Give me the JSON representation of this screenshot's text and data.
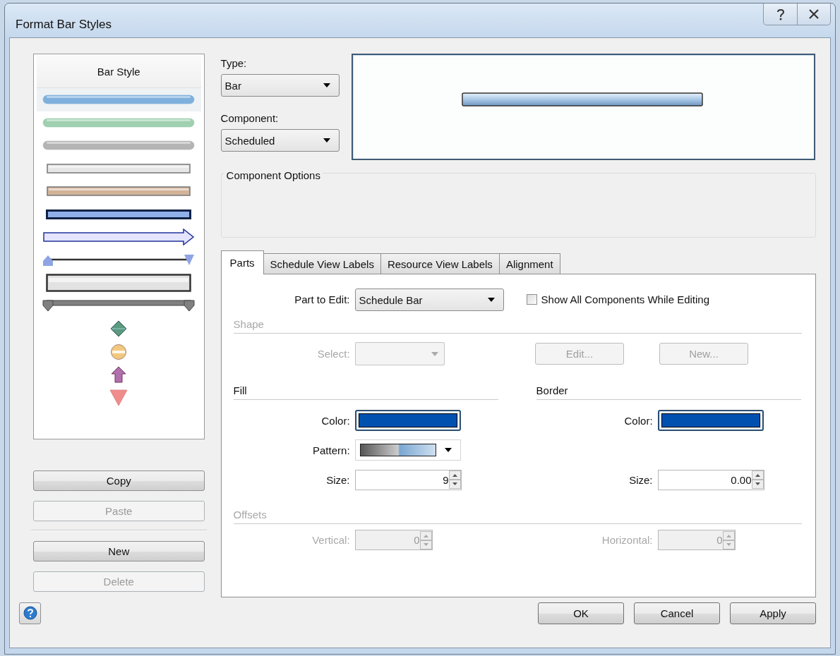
{
  "window": {
    "title": "Format Bar Styles"
  },
  "bar_styles": {
    "header": "Bar Style",
    "items": [
      {
        "kind": "rounded",
        "color": "#7fb0dd",
        "selected": true
      },
      {
        "kind": "rounded",
        "color": "#9fd0b0",
        "selected": false
      },
      {
        "kind": "rounded",
        "color": "#b4b4b4",
        "selected": false
      },
      {
        "kind": "flat",
        "color": "#e6e6e6",
        "selected": false
      },
      {
        "kind": "flat",
        "color": "#d2b398",
        "selected": false
      },
      {
        "kind": "outlined",
        "color": "#8fb0ea",
        "selected": false
      },
      {
        "kind": "arrow",
        "color": "#e4e4ff",
        "selected": false
      },
      {
        "kind": "range",
        "color": "#8ea4e4",
        "selected": false
      },
      {
        "kind": "box",
        "color": "#e2e2e2",
        "selected": false
      },
      {
        "kind": "span",
        "color": "#808080",
        "selected": false
      },
      {
        "kind": "diamond",
        "color": "#5a9a80",
        "selected": false
      },
      {
        "kind": "circle",
        "color": "#f2c87e",
        "selected": false
      },
      {
        "kind": "up-arrow",
        "color": "#b070b0",
        "selected": false
      },
      {
        "kind": "down-triangle",
        "color": "#f08c8c",
        "selected": false
      }
    ]
  },
  "list_buttons": [
    {
      "label": "Copy",
      "disabled": false
    },
    {
      "label": "Paste",
      "disabled": true
    },
    {
      "label": "New",
      "disabled": false
    },
    {
      "label": "Delete",
      "disabled": true
    }
  ],
  "type": {
    "label": "Type:",
    "value": "Bar"
  },
  "component": {
    "label": "Component:",
    "value": "Scheduled"
  },
  "component_options": {
    "title": "Component Options"
  },
  "tabs": [
    {
      "label": "Parts",
      "selected": true
    },
    {
      "label": "Schedule View Labels",
      "selected": false
    },
    {
      "label": "Resource View Labels",
      "selected": false
    },
    {
      "label": "Alignment",
      "selected": false
    }
  ],
  "parts": {
    "part_to_edit": {
      "label": "Part to Edit:",
      "value": "Schedule Bar"
    },
    "show_all": {
      "label": "Show All Components While Editing",
      "checked": false
    },
    "shape": {
      "title": "Shape",
      "disabled": true,
      "select_label": "Select:",
      "buttons": [
        "Edit...",
        "New..."
      ]
    },
    "fill": {
      "title": "Fill",
      "color_label": "Color:",
      "color": "#0050b0",
      "pattern_label": "Pattern:",
      "size_label": "Size:",
      "size": "9"
    },
    "border": {
      "title": "Border",
      "color_label": "Color:",
      "color": "#0050b0",
      "size_label": "Size:",
      "size": "0.00"
    },
    "offsets": {
      "title": "Offsets",
      "disabled": true,
      "fields": [
        {
          "label": "Vertical:",
          "value": "0"
        },
        {
          "label": "Horizontal:",
          "value": "0"
        }
      ]
    }
  },
  "buttons": [
    {
      "label": "OK"
    },
    {
      "label": "Cancel"
    },
    {
      "label": "Apply"
    }
  ]
}
